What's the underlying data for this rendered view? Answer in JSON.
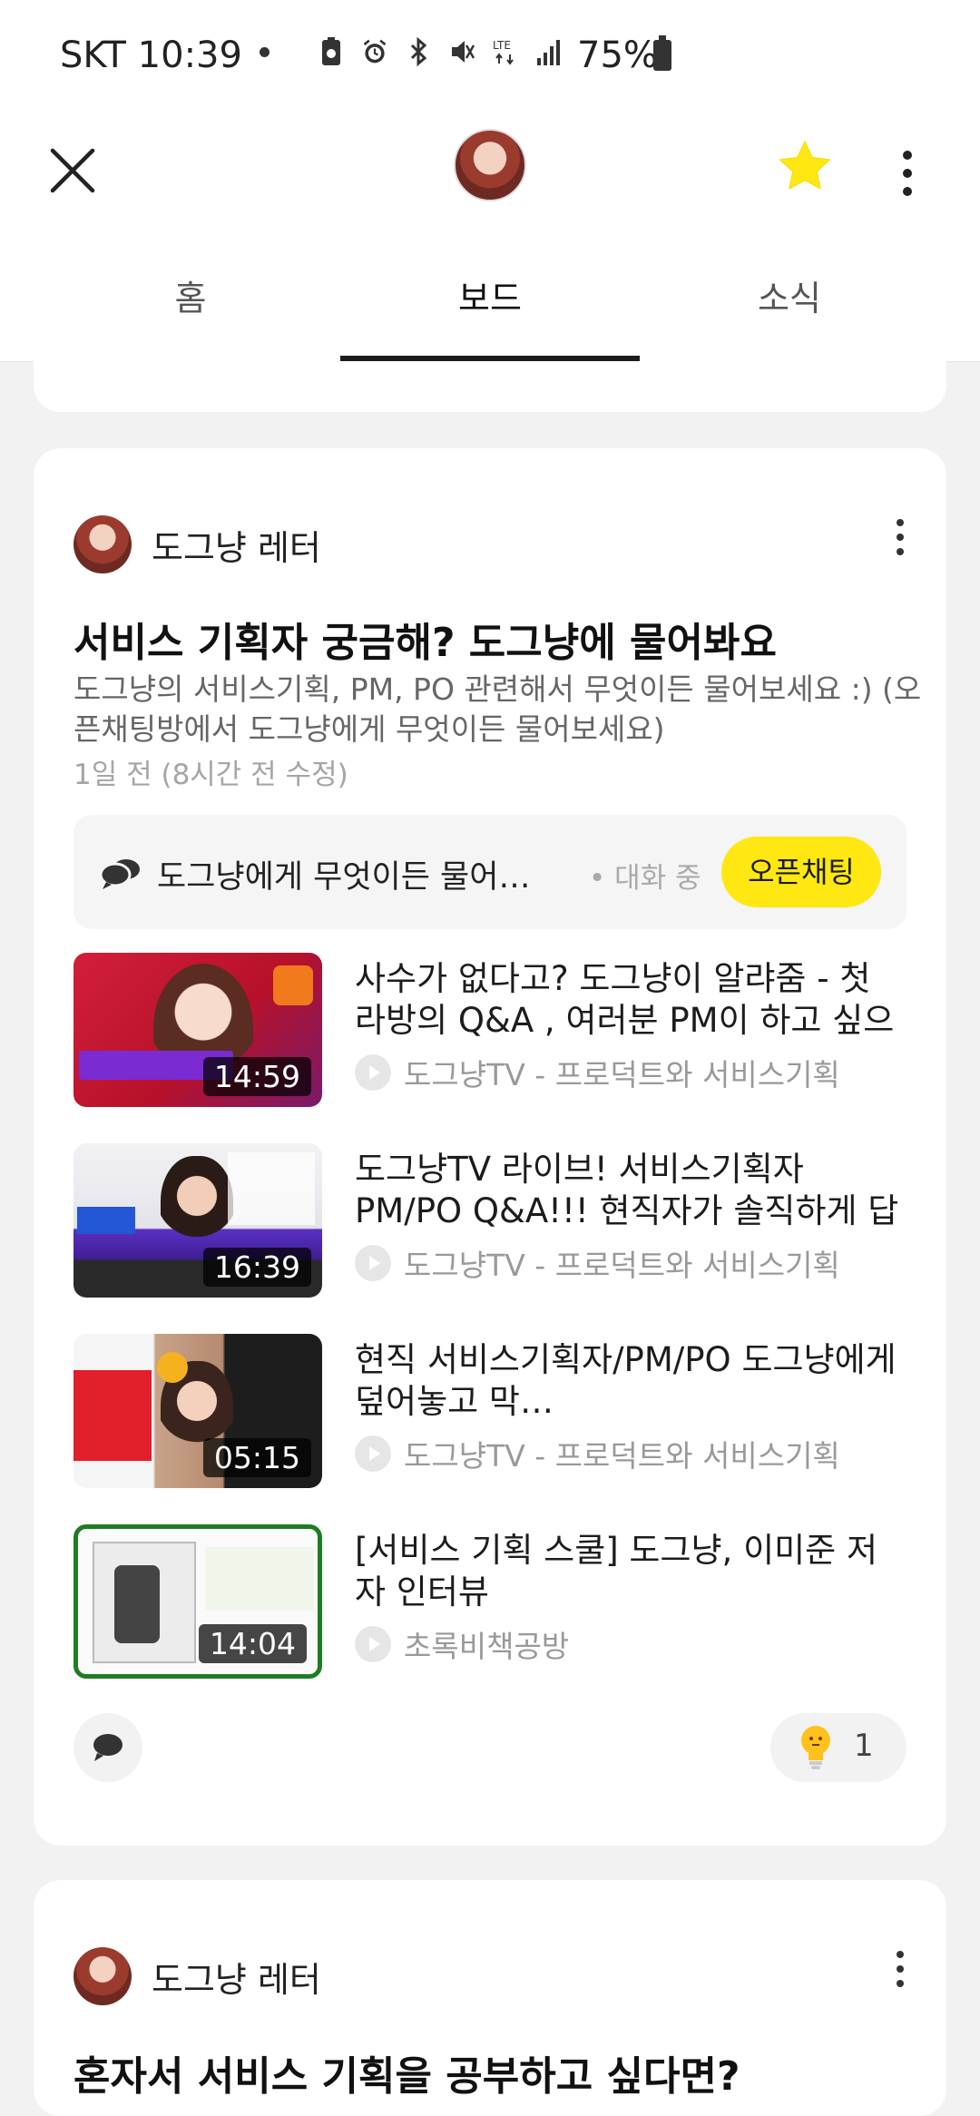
{
  "status_bar": {
    "carrier_time": "SKT 10:39",
    "battery": "75%",
    "icons": [
      "battery-saver-icon",
      "alarm-icon",
      "bluetooth-icon",
      "mute-icon",
      "lte-icon",
      "signal-icon"
    ]
  },
  "app_bar": {
    "close_icon": "close-icon",
    "star_color": "#ffe812",
    "more_icon": "more-vertical-icon"
  },
  "tabs": [
    {
      "label": "홈"
    },
    {
      "label": "보드"
    },
    {
      "label": "소식"
    }
  ],
  "active_tab": "보드",
  "post": {
    "author": "도그냥 레터",
    "title": "서비스 기획자 궁금해? 도그냥에 물어봐요",
    "description": "도그냥의 서비스기획, PM, PO 관련해서 무엇이든 물어보세요 :) (오픈채팅방에서 도그냥에게 무엇이든 물어보세요)",
    "time": "1일 전 (8시간 전 수정)",
    "chat": {
      "text": "도그냥에게 무엇이든 물어보세요",
      "status": "• 대화 중",
      "button": "오픈채팅"
    },
    "videos": [
      {
        "title": "사수가 없다고? 도그냥이 알랴줌 - 첫 라방의 Q&A , 여러분 PM이 하고 싶으세요?",
        "source": "도그냥TV - 프로덕트와 서비스기획",
        "duration": "14:59"
      },
      {
        "title": "도그냥TV 라이브! 서비스기획자 PM/PO Q&A!!! 현직자가 솔직하게 답합니다",
        "source": "도그냥TV - 프로덕트와 서비스기획",
        "duration": "16:39"
      },
      {
        "title": "현직 서비스기획자/PM/PO 도그냥에게 덮어놓고 막…",
        "source": "도그냥TV - 프로덕트와 서비스기획",
        "duration": "05:15"
      },
      {
        "title": "[서비스 기획 스쿨] 도그냥, 이미준 저자 인터뷰",
        "source": "초록비책공방",
        "duration": "14:04"
      }
    ],
    "like_count": "1"
  },
  "next_post": {
    "author": "도그냥 레터",
    "title": "혼자서 서비스 기획을 공부하고 싶다면?"
  }
}
